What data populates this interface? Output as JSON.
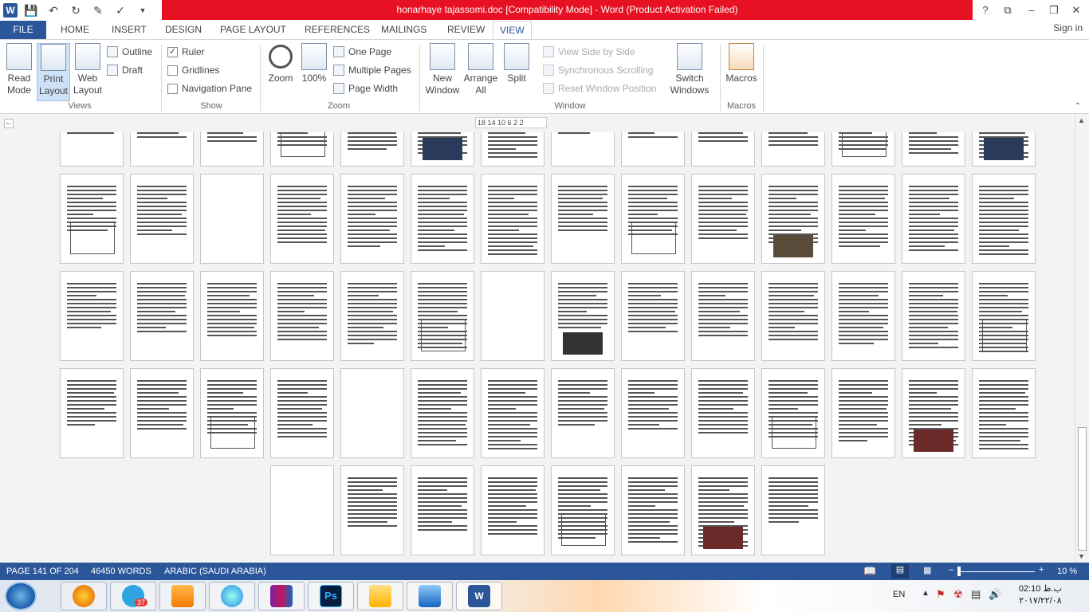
{
  "window": {
    "title": "honarhaye tajassomi.doc [Compatibility Mode] - Word (Product Activation Failed)",
    "controls": [
      "?",
      "⧉",
      "–",
      "❐",
      "✕"
    ]
  },
  "qat": {
    "icons": [
      "word-icon",
      "save-icon",
      "undo-icon",
      "redo-icon",
      "form-icon",
      "spellcheck-icon"
    ]
  },
  "tabs": [
    "FILE",
    "HOME",
    "INSERT",
    "DESIGN",
    "PAGE LAYOUT",
    "REFERENCES",
    "MAILINGS",
    "REVIEW",
    "VIEW"
  ],
  "active_tab": "VIEW",
  "signin": "Sign in",
  "ribbon": {
    "views": {
      "label": "Views",
      "read_mode": "Read Mode",
      "print_layout": "Print Layout",
      "web_layout": "Web Layout",
      "outline": "Outline",
      "draft": "Draft"
    },
    "show": {
      "label": "Show",
      "ruler": "Ruler",
      "gridlines": "Gridlines",
      "navigation_pane": "Navigation Pane",
      "ruler_checked": true,
      "gridlines_checked": false,
      "navigation_checked": false
    },
    "zoom": {
      "label": "Zoom",
      "zoom": "Zoom",
      "pct100": "100%",
      "one_page": "One Page",
      "multiple_pages": "Multiple Pages",
      "page_width": "Page Width"
    },
    "window": {
      "label": "Window",
      "new_window": "New Window",
      "arrange_all": "Arrange All",
      "split": "Split",
      "view_side_by_side": "View Side by Side",
      "synchronous_scrolling": "Synchronous Scrolling",
      "reset_window_position": "Reset Window Position",
      "switch_windows": "Switch Windows"
    },
    "macros": {
      "label": "Macros",
      "macros": "Macros"
    }
  },
  "ruler_marks": "18 14 10 6 2 2",
  "status": {
    "page": "PAGE 141 OF 204",
    "words": "46450 WORDS",
    "language": "ARABIC (SAUDI ARABIA)",
    "zoom": "10 %"
  },
  "taskbar": {
    "telegram_badge": "37",
    "lang": "EN",
    "time": "02:10 ب.ظ",
    "date": "۲۰۱۷/۲۲/۰۸"
  }
}
